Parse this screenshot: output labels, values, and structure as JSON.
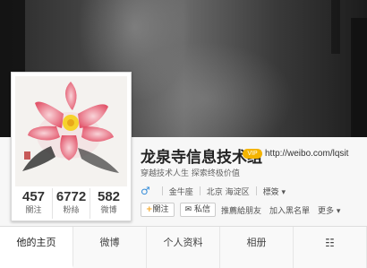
{
  "header": {
    "name": "龙泉寺信息技术组",
    "vip_badge": "VIP",
    "url": "http://weibo.com/lqsit",
    "bio": "穿越技术人生 探索终极价值",
    "gender_symbol": "♂",
    "constellation": "金牛座",
    "location": "北京 海淀区",
    "tags_label": "標簽 ▾"
  },
  "stats": [
    {
      "value": "457",
      "label": "關注"
    },
    {
      "value": "6772",
      "label": "粉絲"
    },
    {
      "value": "582",
      "label": "微博"
    }
  ],
  "actions": {
    "follow": "關注",
    "message": "私信",
    "recommend": "推薦給朋友",
    "block": "加入黑名單",
    "more": "更多 ▾"
  },
  "tabs": [
    "他的主页",
    "微博",
    "个人资料",
    "相册",
    "☷"
  ],
  "colors": {
    "accent": "#f5a623",
    "link": "#3a8fd9"
  }
}
